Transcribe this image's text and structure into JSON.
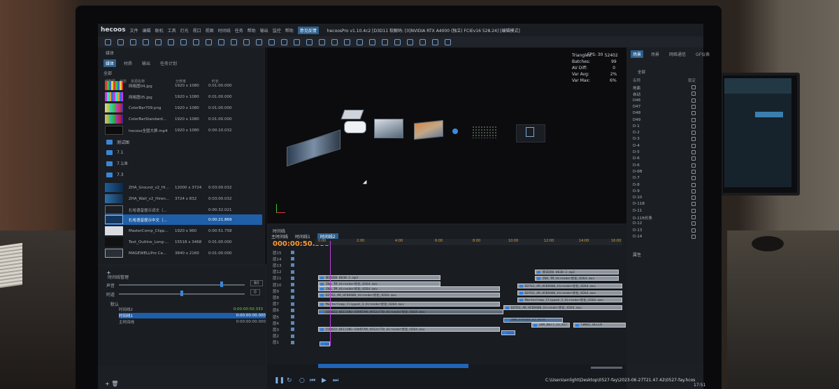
{
  "app": {
    "logo": "hecoos",
    "window_title": "hecoosPro v1.10.4c2 [D3D11 软解码: [0]NVIDIA RTX A4000 (独立) FCIEv16 528.24] [编辑模式]",
    "menu": [
      "文件",
      "编辑",
      "联机",
      "工具",
      "灯光",
      "视口",
      "视图",
      "时间线",
      "任务",
      "帮助",
      "输出",
      "监控",
      "帮助",
      "意见反馈"
    ],
    "active_menu": "意见反馈",
    "brand_color": "#2c5f8d"
  },
  "media_panel": {
    "title": "媒体",
    "tabs": [
      "媒体",
      "材质",
      "输出",
      "任务计划"
    ],
    "active_tab": "媒体",
    "filter": "全部",
    "columns": [
      "缩略图",
      "状态",
      "资源名称",
      "分辨率",
      "时长"
    ],
    "items_top": [
      {
        "name": "网格图04.jpg",
        "res": "1920 x 1080",
        "dur": "0:01:00.000"
      },
      {
        "name": "网格图05.jpg",
        "res": "1920 x 1080",
        "dur": "0:01:00.000"
      },
      {
        "name": "ColorBar709.png",
        "res": "1920 x 1080",
        "dur": "0:01:00.000"
      },
      {
        "name": "ColorBarStandard...",
        "res": "1920 x 1080",
        "dur": "0:01:00.000"
      },
      {
        "name": "hecoos全国大屏.mp4",
        "res": "1920 x 1080",
        "dur": "0:00:10.032"
      }
    ],
    "folders": [
      "测试图",
      "7.1",
      "7.1/8",
      "7.3"
    ],
    "items_bottom": [
      {
        "name": "ZHA_Ground_v2_Hi...",
        "res": "12000 x 3724",
        "dur": "0:03:00.032"
      },
      {
        "name": "ZHA_Wall_v2_Hiren...",
        "res": "3724 x 832",
        "dur": "0:03:00.032"
      },
      {
        "name": "扎哈语音提示词文（...",
        "res": "",
        "dur": "0:00:32.021"
      },
      {
        "name": "扎哈语音提示中文（...",
        "res": "",
        "dur": "0:00:21.869"
      },
      {
        "name": "MasterComp_Clipp...",
        "res": "1920 x 960",
        "dur": "0:00:51.758"
      },
      {
        "name": "Text_Outline_Long-...",
        "res": "15518 x 3468",
        "dur": "0:01:00.000"
      },
      {
        "name": "MAGEWELLPro Ca...",
        "res": "3840 x 2160",
        "dur": "0:01:00.000"
      }
    ],
    "selected_index": 3
  },
  "timeline_manager": {
    "title": "时间线管理",
    "volume_label": "声音",
    "volume_value": "80",
    "alpha_label": "阿道",
    "alpha_value": "0",
    "group": "默认",
    "rows": [
      {
        "name": "时间线2",
        "time": "0:00:00:50.333"
      },
      {
        "name": "时间线1",
        "time": "0:00:00:00.000"
      },
      {
        "name": "主时间线",
        "time": "0:00:00:00.000"
      }
    ]
  },
  "viewport": {
    "fps": "FPS: 30",
    "stats_labels": [
      "Triangles:",
      "Batches:",
      "AV Diff:",
      "Var Avg:",
      "Var Max:"
    ],
    "stats_values": [
      "52402",
      "99",
      "0",
      "2%",
      "6%"
    ]
  },
  "right_panel": {
    "tabs": [
      "场景",
      "场景",
      "网络通信",
      "GF仪表"
    ],
    "filter": "全部",
    "columns": [
      "名称",
      "锁定"
    ],
    "items": [
      "地面",
      "自动",
      "D46",
      "D47",
      "D48",
      "D49",
      "D-1",
      "D-2",
      "D-3",
      "D-4",
      "D-5",
      "D-6",
      "D-6",
      "D-6B",
      "D-7",
      "D-8",
      "D-9",
      "D-10",
      "D-11B",
      "D-11",
      "D-11B长条",
      "D-12",
      "D-13",
      "D-14"
    ],
    "props_title": "属性"
  },
  "timeline": {
    "title": "时间线",
    "tabs": [
      "主时间线",
      "时间线1",
      "时间线2"
    ],
    "active_tab": "时间线2",
    "timecode": "000:00:50.333",
    "ruler": [
      "0:00",
      "2:00",
      "4:00",
      "6:00",
      "8:00",
      "10:00",
      "12:00",
      "14:00",
      "16:00"
    ],
    "tracks": [
      "层15",
      "层14",
      "层13",
      "层12",
      "层11",
      "层10",
      "层9",
      "层8",
      "层7",
      "层6",
      "层5",
      "层4",
      "层3",
      "层2",
      "层1"
    ],
    "clips": [
      "新日间0 0630-2.mp3",
      "ZHA_TM_Hirender优化_H264.mov",
      "D2761_AR_HC09406_Hirender优化_H264.mov",
      "MasterComp_Clipped_3_Hirender优化_H264.mov",
      "210622_BEIJING-CHARTAM_4932x770_Hirender优化_H264.mov",
      "ZHA_Ground_v2_Hire",
      "ZHA_Wall_v2_Hir",
      "CW002_BELIN"
    ],
    "status_path": "C:\\Users\\enlight\\Desktop\\0527-fay\\2023-06-27T21.47.42\\0527-fay.hcos"
  },
  "taskbar": {
    "time": "17:51"
  }
}
